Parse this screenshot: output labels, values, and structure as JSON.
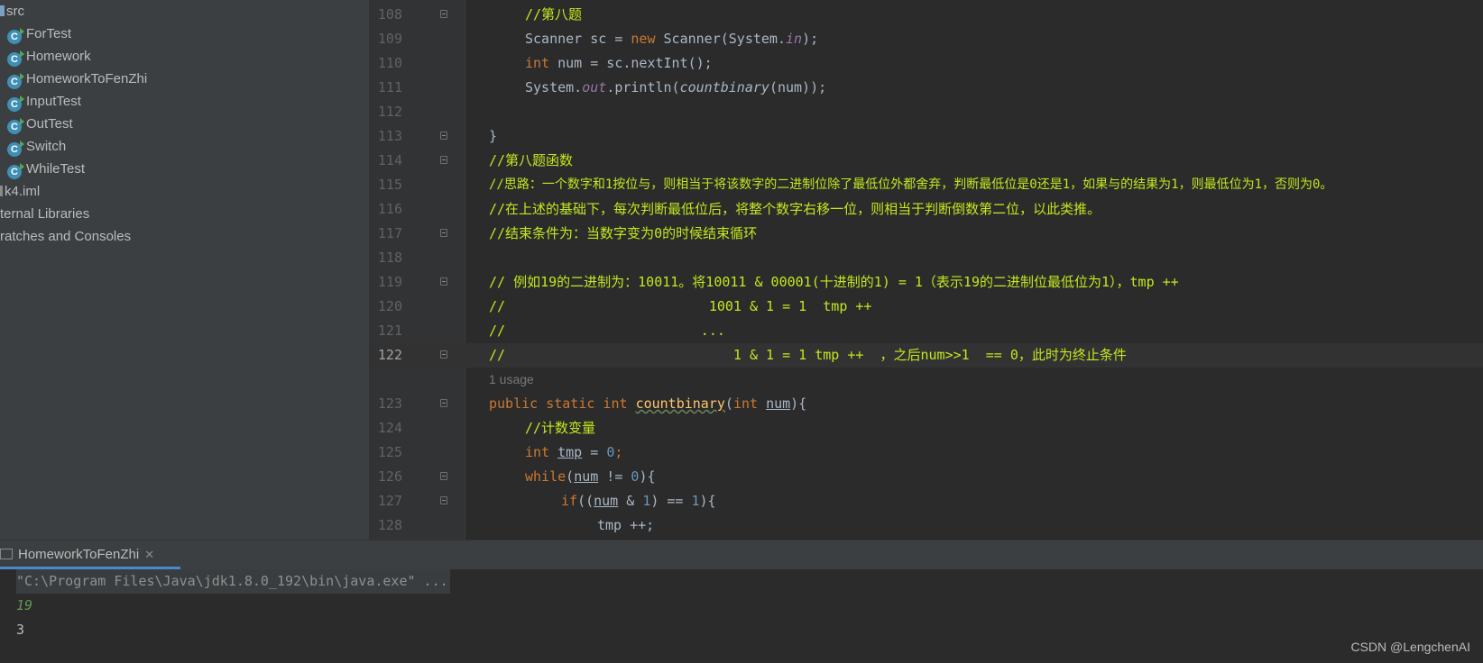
{
  "project_tree": {
    "src_label": "src",
    "classes": [
      "ForTest",
      "Homework",
      "HomeworkToFenZhi",
      "InputTest",
      "OutTest",
      "Switch",
      "WhileTest"
    ],
    "iml_file": "k4.iml",
    "external_libraries": "ternal Libraries",
    "scratches": "ratches and Consoles"
  },
  "editor": {
    "line_numbers": [
      "108",
      "109",
      "110",
      "111",
      "112",
      "113",
      "114",
      "115",
      "116",
      "117",
      "118",
      "119",
      "120",
      "121",
      "122",
      "123",
      "124",
      "125",
      "126",
      "127",
      "128"
    ],
    "current_line": "122",
    "usage_hint": "1 usage",
    "code": {
      "l108": "//第八题",
      "l109_a": "Scanner sc = ",
      "l109_kw": "new",
      "l109_b": " Scanner(System.",
      "l109_it": "in",
      "l109_c": ");",
      "l110_kw": "int",
      "l110_rest": " num = sc.nextInt();",
      "l111_a": "System.",
      "l111_it": "out",
      "l111_b": ".println(",
      "l111_fn": "countbinary",
      "l111_c": "(num));",
      "l113": "}",
      "l114": "//第八题函数",
      "l115": "//思路：一个数字和1按位与，则相当于将该数字的二进制位除了最低位外都舍弃，判断最低位是0还是1，如果与的结果为1，则最低位为1，否则为0。",
      "l116": "//在上述的基础下，每次判断最低位后，将整个数字右移一位，则相当于判断倒数第二位，以此类推。",
      "l117": "//结束条件为：当数字变为0的时候结束循环",
      "l119": "// 例如19的二进制为：10011。将10011 & 00001(十进制的1) = 1（表示19的二进制位最低位为1），tmp ++",
      "l120": "//                         1001 & 1 = 1  tmp ++",
      "l121": "//                        ...",
      "l122": "//                            1 & 1 = 1 tmp ++  ，之后num>>1  == 0，此时为终止条件",
      "l123_kw": "public static int ",
      "l123_fn": "countbinary",
      "l123_a": "(",
      "l123_kw2": "int ",
      "l123_var": "num",
      "l123_b": "){",
      "l124": "//计数变量",
      "l125_kw": "int ",
      "l125_var": "tmp",
      "l125_a": " = ",
      "l125_num": "0",
      "l125_b": ";",
      "l126_kw": "while",
      "l126_a": "(",
      "l126_var": "num",
      "l126_b": " != ",
      "l126_num": "0",
      "l126_c": "){",
      "l127_kw": "if",
      "l127_a": "((",
      "l127_var": "num",
      "l127_b": " & ",
      "l127_num": "1",
      "l127_c": ") == ",
      "l127_num2": "1",
      "l127_d": "){",
      "l128": "tmp ++;"
    }
  },
  "run_panel": {
    "tab_label": "HomeworkToFenZhi",
    "command": "\"C:\\Program Files\\Java\\jdk1.8.0_192\\bin\\java.exe\" ...",
    "input_value": "19",
    "output_value": "3"
  },
  "watermark": "CSDN @LengchenAI"
}
